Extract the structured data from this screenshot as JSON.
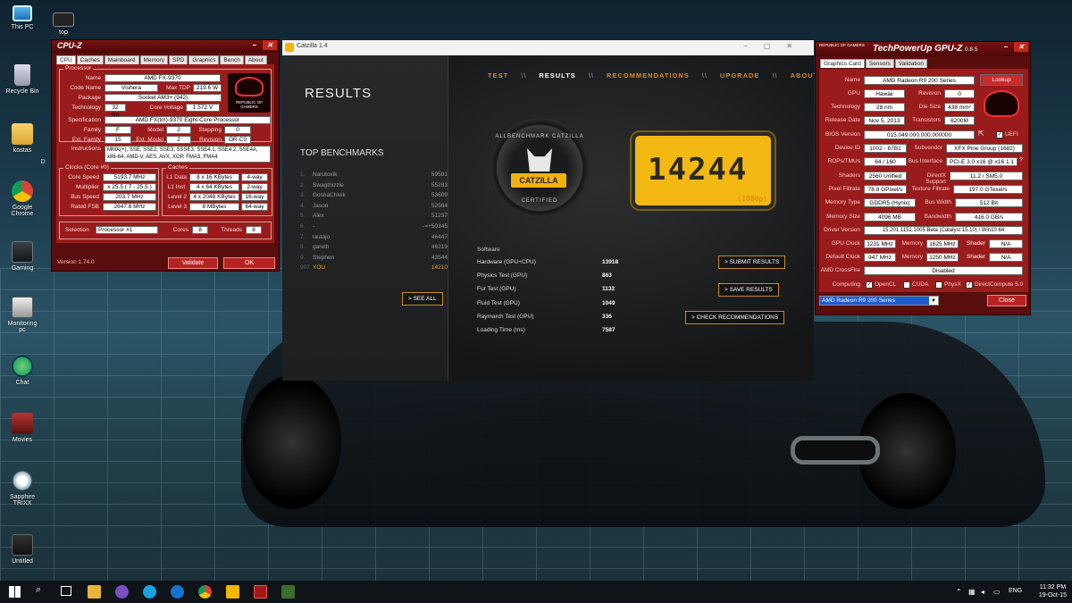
{
  "desktop": {
    "icons": [
      {
        "label": "This PC"
      },
      {
        "label": "top"
      },
      {
        "label": "Recycle Bin"
      },
      {
        "label": "kostas"
      },
      {
        "label": "D"
      },
      {
        "label": "Google Chrome"
      },
      {
        "label": "Gaming"
      },
      {
        "label": "Monitoring pc"
      },
      {
        "label": "Chat"
      },
      {
        "label": "Movies"
      },
      {
        "label": "Sapphire TRIXX"
      },
      {
        "label": "Untitled"
      }
    ]
  },
  "cpuz": {
    "title": "CPU-Z",
    "tabs": [
      "CPU",
      "Caches",
      "Mainboard",
      "Memory",
      "SPD",
      "Graphics",
      "Bench",
      "About"
    ],
    "processor_label": "Processor",
    "name_label": "Name",
    "name": "AMD FX-9370",
    "code_name_label": "Code Name",
    "code_name": "Vishera",
    "max_tdp_label": "Max TDP",
    "max_tdp": "219.6 W",
    "package_label": "Package",
    "package": "Socket AM3+ (942)",
    "technology_label": "Technology",
    "technology": "32 nm",
    "core_voltage_label": "Core Voltage",
    "core_voltage": "1.572 V",
    "spec_label": "Specification",
    "spec": "AMD FX(tm)-9370 Eight-Core Processor",
    "family_label": "Family",
    "family": "F",
    "model_label": "Model",
    "model": "2",
    "stepping_label": "Stepping",
    "stepping": "0",
    "ext_family_label": "Ext. Family",
    "ext_family": "15",
    "ext_model_label": "Ext. Model",
    "ext_model": "2",
    "revision_label": "Revision",
    "revision": "OR-C0",
    "instructions_label": "Instructions",
    "instructions": "MMX(+), SSE, SSE2, SSE3, SSSE3, SSE4.1, SSE4.2, SSE4A, x86-64, AMD-V, AES, AVX, XOP, FMA3, FMA4",
    "clocks_label": "Clocks (Core #0)",
    "core_speed_label": "Core Speed",
    "core_speed": "5193.7 MHz",
    "multiplier_label": "Multiplier",
    "multiplier": "x 25.5 ( 7 - 25.5 )",
    "bus_speed_label": "Bus Speed",
    "bus_speed": "203.7 MHz",
    "rated_fsb_label": "Rated FSB",
    "rated_fsb": "2647.8 MHz",
    "caches_label": "Caches",
    "l1d_label": "L1 Data",
    "l1d": "8 x 16 KBytes",
    "l1d_way": "4-way",
    "l1i_label": "L1 Inst.",
    "l1i": "4 x 64 KBytes",
    "l1i_way": "2-way",
    "l2_label": "Level 2",
    "l2": "4 x 2048 KBytes",
    "l2_way": "16-way",
    "l3_label": "Level 3",
    "l3": "8 MBytes",
    "l3_way": "64-way",
    "selection_label": "Selection",
    "selection": "Processor #1",
    "cores_label": "Cores",
    "cores": "8",
    "threads_label": "Threads",
    "threads": "8",
    "version": "Version 1.74.0",
    "validate": "Validate",
    "ok": "OK",
    "rog_text": "REPUBLIC OF GAMERS"
  },
  "catzilla": {
    "title": "Catzilla 1.4",
    "nav": [
      "TEST",
      "RESULTS",
      "RECOMMENDATIONS",
      "UPGRADE",
      "ABOUT"
    ],
    "heading": "RESULTS",
    "top_benchmarks": "TOP BENCHMARKS",
    "benchmarks": [
      {
        "rank": "1.",
        "name": "Narutoxik",
        "score": "59581"
      },
      {
        "rank": "2.",
        "name": "Swagthizzle",
        "score": "55283"
      },
      {
        "rank": "3.",
        "name": "GoshaChivik",
        "score": "53609"
      },
      {
        "rank": "4.",
        "name": "Jason",
        "score": "52564"
      },
      {
        "rank": "5.",
        "name": "Alex",
        "score": "51237"
      },
      {
        "rank": "6.",
        "name": "-",
        "score": "-=+50345"
      },
      {
        "rank": "7.",
        "name": "lautajo",
        "score": "46447"
      },
      {
        "rank": "8.",
        "name": "gareth",
        "score": "46219"
      },
      {
        "rank": "9.",
        "name": "Stephen",
        "score": "43544"
      },
      {
        "rank": "907.",
        "name": "YOU",
        "score": "14210"
      }
    ],
    "see_all": "> SEE ALL",
    "badge_top": "ALLBENCHMARK CATZILLA",
    "badge_label": "CATZILLA",
    "badge_bottom": "CERTIFIED",
    "score": "14244",
    "resolution": "(1080p)",
    "software_label": "Software",
    "results": [
      {
        "name": "Hardware (GPU+CPU)",
        "value": "13918"
      },
      {
        "name": "Physics Test (GPU)",
        "value": "863"
      },
      {
        "name": "Fur Test (GPU)",
        "value": "1132"
      },
      {
        "name": "Fluid Test (GPU)",
        "value": "1049"
      },
      {
        "name": "Raymarch Test (GPU)",
        "value": "336"
      },
      {
        "name": "Loading Time (ms)",
        "value": "7587"
      }
    ],
    "submit": "> SUBMIT RESULTS",
    "save": "> SAVE RESULTS",
    "check": "> CHECK RECOMMENDATIONS"
  },
  "gpuz": {
    "title": "TechPowerUp GPU-Z",
    "version": "0.8.5",
    "rog_text": "REPUBLIC OF GAMERS",
    "tabs": [
      "Graphics Card",
      "Sensors",
      "Validation"
    ],
    "name_label": "Name",
    "name": "AMD Radeon R9 200 Series",
    "lookup": "Lookup",
    "gpu_label": "GPU",
    "gpu": "Hawaii",
    "revision_label": "Revision",
    "revision": "0",
    "technology_label": "Technology",
    "technology": "28 nm",
    "die_size_label": "Die Size",
    "die_size": "438 mm²",
    "release_label": "Release Date",
    "release": "Nov 5, 2013",
    "transistors_label": "Transistors",
    "transistors": "6200M",
    "bios_label": "BIOS Version",
    "bios": "015.049.000.000.000000",
    "uefi": "UEFI",
    "device_id_label": "Device ID",
    "device_id": "1002 - 67B1",
    "subvendor_label": "Subvendor",
    "subvendor": "XFX Pine Group (1682)",
    "rops_label": "ROPs/TMUs",
    "rops": "64 / 160",
    "bus_label": "Bus Interface",
    "bus": "PCI-E 3.0 x16 @ x16 1.1",
    "shaders_label": "Shaders",
    "shaders": "2560 Unified",
    "dx_label": "DirectX Support",
    "dx": "11.2 / SM5.0",
    "pixel_label": "Pixel Fillrate",
    "pixel": "78.8 GPixel/s",
    "texture_label": "Texture Fillrate",
    "texture": "197.0 GTexel/s",
    "mem_type_label": "Memory Type",
    "mem_type": "GDDR5 (Hynix)",
    "bus_width_label": "Bus Width",
    "bus_width": "512 Bit",
    "mem_size_label": "Memory Size",
    "mem_size": "4096 MB",
    "bandwidth_label": "Bandwidth",
    "bandwidth": "416.0 GB/s",
    "driver_label": "Driver Version",
    "driver": "15.201.1151.1005 Beta (Catalyst 15.10) / Win10 64",
    "gpu_clock_label": "GPU Clock",
    "gpu_clock": "1231 MHz",
    "memory_label": "Memory",
    "memory_clock": "1625 MHz",
    "shader_label": "Shader",
    "shader_val": "N/A",
    "default_clock_label": "Default Clock",
    "default_clock": "947 MHz",
    "default_memory": "1250 MHz",
    "default_shader": "N/A",
    "crossfire_label": "AMD CrossFire",
    "crossfire": "Disabled",
    "computing_label": "Computing",
    "opencl": "OpenCL",
    "cuda": "CUDA",
    "physx": "PhysX",
    "directcompute": "DirectCompute 5.0",
    "selected_card": "AMD Radeon R9 200 Series",
    "close": "Close"
  },
  "taskbar": {
    "lang": "ENG",
    "time": "11:32 PM",
    "date": "19-Oct-15"
  }
}
